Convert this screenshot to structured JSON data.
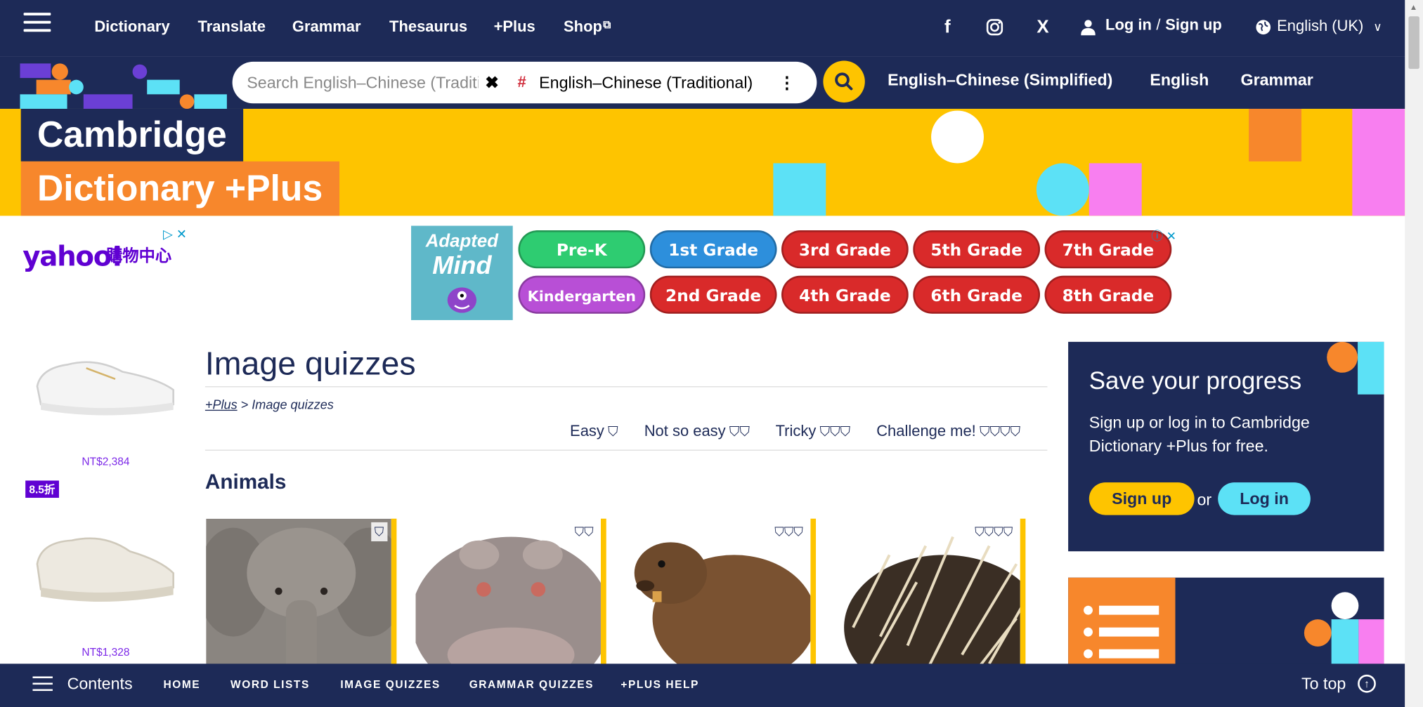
{
  "nav": {
    "links": [
      "Dictionary",
      "Translate",
      "Grammar",
      "Thesaurus",
      "+Plus",
      "Shop"
    ],
    "shop_icon": "external-link-icon",
    "social": {
      "facebook": "f",
      "instagram": "instagram-icon",
      "x": "X"
    },
    "login": "Log in",
    "separator": "/",
    "signup": "Sign up",
    "language": "English (UK)"
  },
  "search": {
    "placeholder": "Search English–Chinese (Traditional)",
    "clear": "✖",
    "hash": "#",
    "dictionary": "English–Chinese (Traditional)",
    "dictionaries": [
      "English–Chinese (Simplified)",
      "English",
      "Grammar"
    ]
  },
  "brand": {
    "line1": "Cambridge",
    "line2": "Dictionary +Plus"
  },
  "ads": {
    "left": {
      "brand": "yahoo!",
      "brand_cn": "購物中心",
      "price1": "NT$2,384",
      "discount": "8.5折",
      "price2": "NT$1,328"
    },
    "top": {
      "logo_line1": "Adapted",
      "logo_line2": "Mind",
      "grades": [
        "Pre-K",
        "1st Grade",
        "3rd Grade",
        "5th Grade",
        "7th Grade",
        "Kindergarten",
        "2nd Grade",
        "4th Grade",
        "6th Grade",
        "8th Grade"
      ]
    }
  },
  "page": {
    "title": "Image quizzes",
    "breadcrumb_root": "+Plus",
    "breadcrumb_sep": " > ",
    "breadcrumb_current": "Image quizzes",
    "levels": [
      {
        "label": "Easy",
        "shields": 1
      },
      {
        "label": "Not so easy",
        "shields": 2
      },
      {
        "label": "Tricky",
        "shields": 3
      },
      {
        "label": "Challenge me!",
        "shields": 4
      }
    ],
    "section": "Animals",
    "cards": [
      {
        "animal": "elephant",
        "shields": 1
      },
      {
        "animal": "hippopotamus",
        "shields": 2
      },
      {
        "animal": "beaver",
        "shields": 3
      },
      {
        "animal": "porcupine",
        "shields": 4
      }
    ]
  },
  "sidebar": {
    "title": "Save your progress",
    "text": "Sign up or log in to Cambridge Dictionary +Plus for free.",
    "signup": "Sign up",
    "or": "or",
    "login": "Log in"
  },
  "bottom": {
    "contents": "Contents",
    "links": [
      "HOME",
      "WORD LISTS",
      "IMAGE QUIZZES",
      "GRAMMAR QUIZZES",
      "+PLUS HELP"
    ],
    "to_top": "To top"
  },
  "colors": {
    "navy": "#1d2a57",
    "yellow": "#fec400",
    "orange": "#f7872c",
    "cyan": "#5ce1f6",
    "pink": "#f87ff0",
    "purple": "#6b3fd5"
  }
}
